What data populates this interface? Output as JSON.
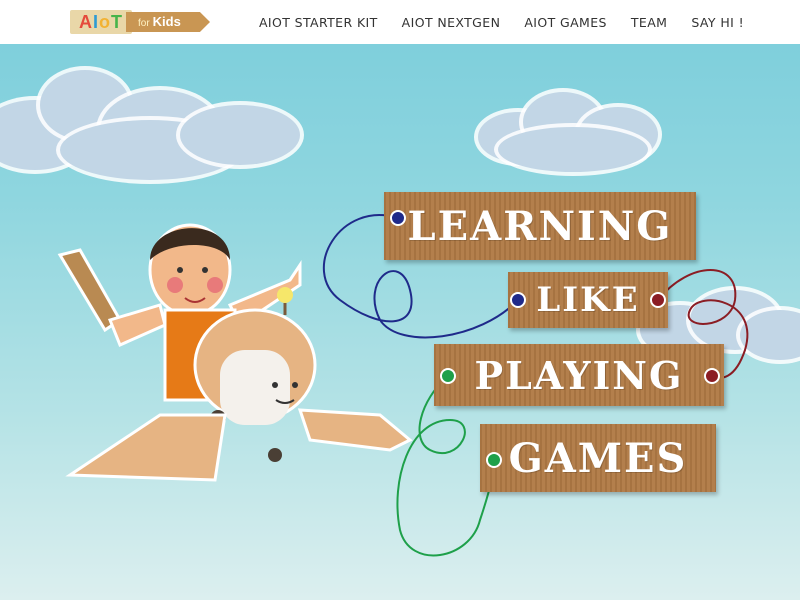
{
  "header": {
    "logo": {
      "aiot_letters": [
        "A",
        "I",
        "o",
        "T"
      ],
      "for_text": "for",
      "kids_text": "Kids"
    },
    "nav": [
      {
        "label": "AIOT STARTER KIT"
      },
      {
        "label": "AIOT NEXTGEN"
      },
      {
        "label": "AIOT GAMES"
      },
      {
        "label": "TEAM"
      },
      {
        "label": "SAY HI !"
      }
    ]
  },
  "hero": {
    "headline": [
      {
        "text": "LEARNING",
        "big_first": true
      },
      {
        "text": "LIKE"
      },
      {
        "text": "PLAYING"
      },
      {
        "text": "GAMES",
        "big_first": true
      }
    ]
  },
  "colors": {
    "sky": "#8fd6df",
    "cardboard": "#b07a45",
    "string_blue": "#1f2a8a",
    "string_red": "#8b1d24",
    "string_green": "#1ea04a"
  }
}
